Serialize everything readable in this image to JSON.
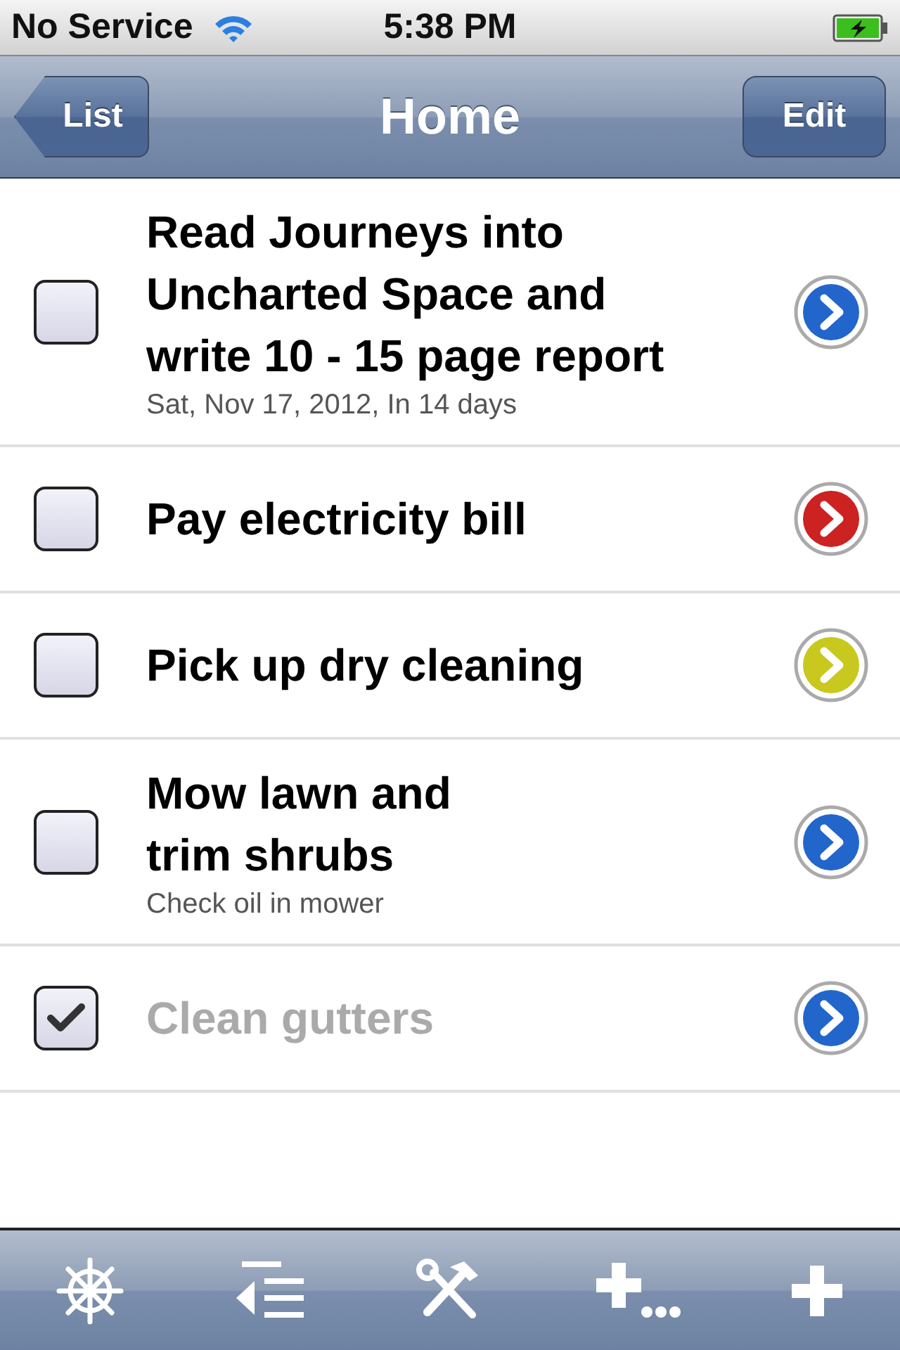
{
  "status_bar": {
    "carrier": "No Service",
    "time": "5:38 PM"
  },
  "nav_bar": {
    "back_button": "List",
    "title": "Home",
    "edit_button": "Edit"
  },
  "tasks": [
    {
      "title": "Read Journeys into\nUncharted Space and\nwrite 10 - 15 page report",
      "note": "Sat, Nov 17, 2012, In 14 days",
      "checked": false,
      "color": "#2266cc"
    },
    {
      "title": "Pay electricity bill",
      "checked": false,
      "color": "#cc2222"
    },
    {
      "title": "Pick up dry cleaning",
      "checked": false,
      "color": "#c8c81e"
    },
    {
      "title": "Mow lawn and\ntrim shrubs",
      "note": "Check oil in mower",
      "checked": false,
      "color": "#2266cc"
    },
    {
      "title": "Clean gutters",
      "checked": true,
      "color": "#2266cc"
    }
  ],
  "toolbar": [
    {
      "kind": "wheel"
    },
    {
      "kind": "outdent"
    },
    {
      "kind": "tools"
    },
    {
      "kind": "addmore"
    },
    {
      "kind": "add"
    }
  ]
}
